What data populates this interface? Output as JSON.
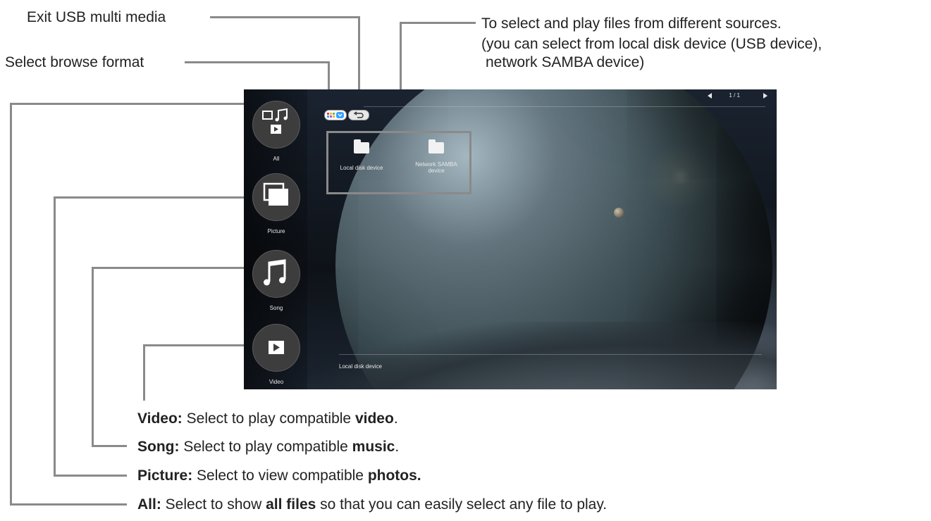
{
  "annotations": {
    "exit": "Exit USB multi media",
    "browse": "Select browse format",
    "sources_line1": "To select and play files from different sources.",
    "sources_line2": "(you can select from local disk device (USB device),",
    "sources_line3": "network SAMBA device)",
    "video_term": "Video:",
    "video_text": "Select to play compatible",
    "video_bold": "video",
    "video_end": ".",
    "song_term": "Song:",
    "song_text": "Select to play compatible",
    "song_bold": "music",
    "song_end": ".",
    "picture_term": "Picture:",
    "picture_text": "Select to view compatible",
    "picture_bold": "photos.",
    "all_term": "All:",
    "all_text": "Select to show",
    "all_bold": "all files",
    "all_end": "so that you can easily select any file to play."
  },
  "screen": {
    "categories": [
      {
        "label": "All",
        "icon": "all-media-icon"
      },
      {
        "label": "Picture",
        "icon": "picture-icon"
      },
      {
        "label": "Song",
        "icon": "music-note-icon"
      },
      {
        "label": "Video",
        "icon": "play-icon"
      }
    ],
    "devices": [
      {
        "label": "Local disk device",
        "icon": "folder-icon"
      },
      {
        "label": "Network SAMBA device",
        "icon": "folder-icon"
      }
    ],
    "pager": "1 / 1",
    "status": "Local disk device",
    "top_buttons": [
      "browse-format-icon",
      "back-icon"
    ]
  },
  "colors": {
    "callout_line": "#8a8a8a",
    "browse_accent": "#3aa0ff"
  }
}
